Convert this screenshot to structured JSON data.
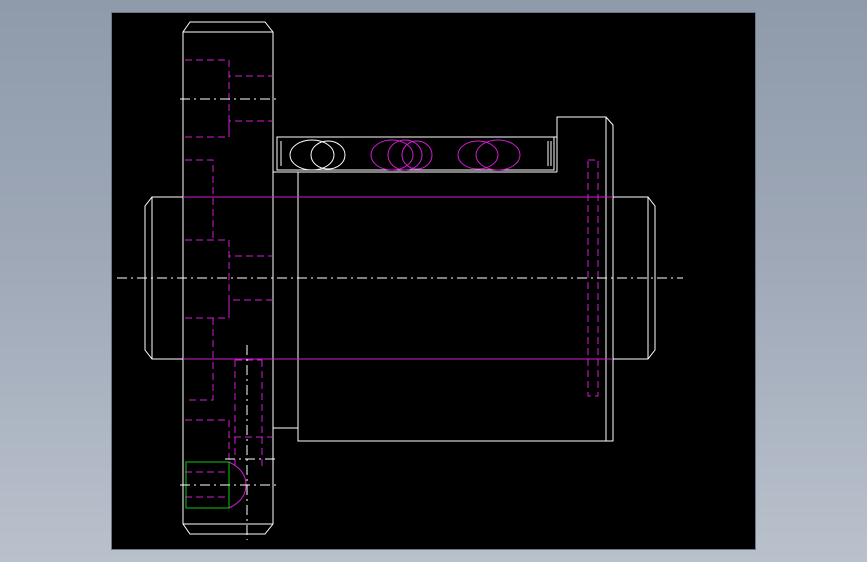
{
  "viewport": {
    "background": "#000000",
    "outline_color": "#ffffff",
    "hidden_line_color": "#d21cd2",
    "highlight_color": "#13c313"
  },
  "drawing": {
    "type": "2d-cad-orthographic-view",
    "subject": "ball-screw-nut-assembly",
    "text_labels": []
  }
}
